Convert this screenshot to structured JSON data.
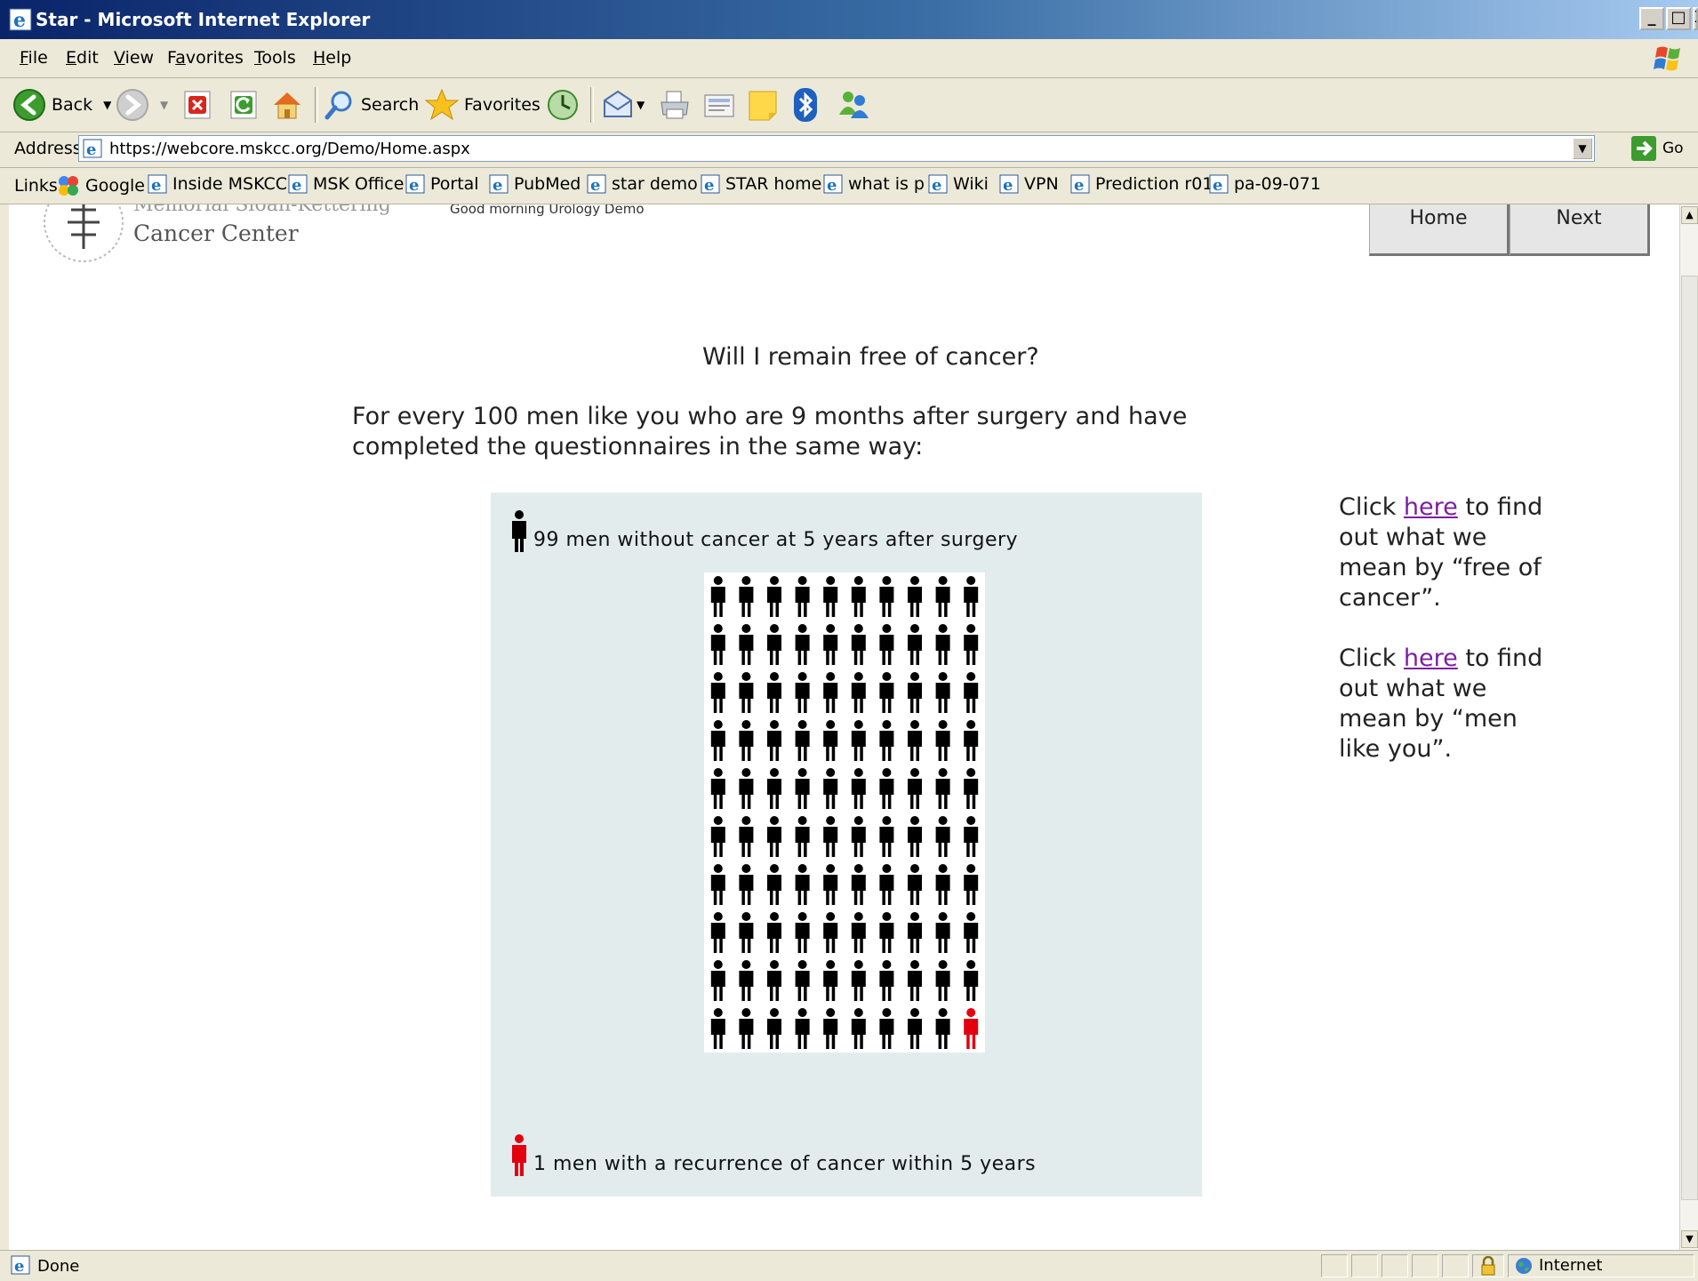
{
  "window": {
    "title": "Star - Microsoft Internet Explorer",
    "controls": [
      "_",
      "□",
      "X"
    ]
  },
  "menu": {
    "items": [
      {
        "key": "F",
        "rest": "ile"
      },
      {
        "key": "E",
        "rest": "dit"
      },
      {
        "key": "V",
        "rest": "iew"
      },
      {
        "pre": "F",
        "key": "a",
        "rest": "vorites"
      },
      {
        "key": "T",
        "rest": "ools"
      },
      {
        "key": "H",
        "rest": "elp"
      }
    ]
  },
  "toolbar": {
    "back_label": "Back",
    "search_label": "Search",
    "favorites_label": "Favorites"
  },
  "address": {
    "label": "Address",
    "url": "https://webcore.mskcc.org/Demo/Home.aspx",
    "go_label": "Go"
  },
  "links": {
    "label": "Links",
    "items": [
      "Google",
      "Inside MSKCC",
      "MSK Office",
      "Portal",
      "PubMed",
      "star demo",
      "STAR home",
      "what is p",
      "Wiki",
      "VPN",
      "Prediction r01",
      "pa-09-071"
    ]
  },
  "page": {
    "logo_line1": "Memorial Sloan-Kettering",
    "logo_line2": "Cancer Center",
    "greeting": "Good morning Urology Demo",
    "nav": {
      "home": "Home",
      "next": "Next"
    },
    "question": "Will I remain free of cancer?",
    "intro": "For every 100 men like you who are 9 months after surgery and have completed the questionnaires in the same way:",
    "legend_without": "99 men without cancer at 5 years after surgery",
    "legend_with": "1 men with a recurrence of cancer within 5 years",
    "side_note_1": {
      "pre": "Click ",
      "link": "here",
      "post": " to find out what we mean by “free of cancer”."
    },
    "side_note_2": {
      "pre": "Click ",
      "link": "here",
      "post": " to find out what we mean by “men like you”."
    }
  },
  "chart_data": {
    "type": "icon-array",
    "total": 100,
    "columns": 10,
    "rows": 10,
    "categories": [
      "99 men without cancer at 5 years after surgery",
      "1 men with a recurrence of cancer within 5 years"
    ],
    "values": [
      99,
      1
    ],
    "colors": [
      "#000000",
      "#e3000f"
    ]
  },
  "status": {
    "text": "Done",
    "zone": "Internet"
  }
}
